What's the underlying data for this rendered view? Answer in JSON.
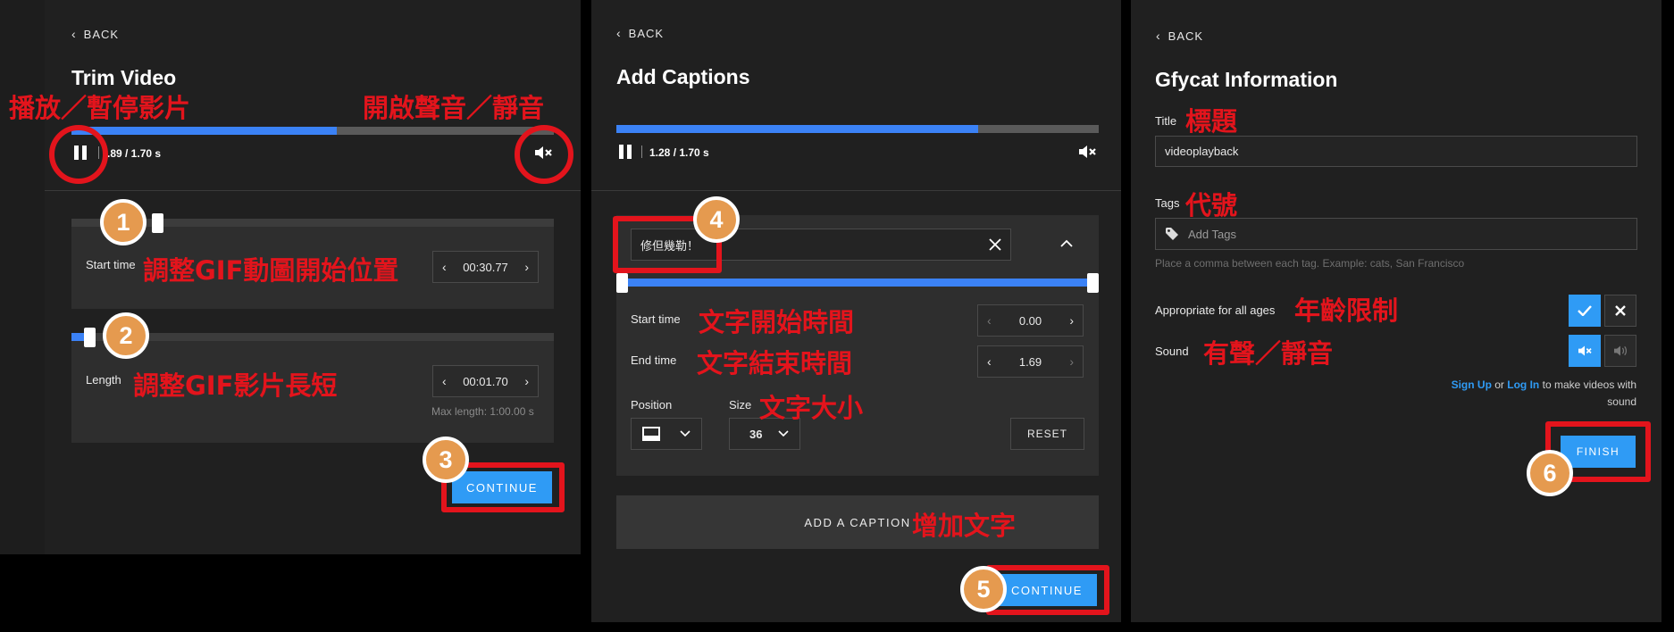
{
  "panel1": {
    "back": "BACK",
    "title": "Trim Video",
    "time": ".89 / 1.70 s",
    "start_label": "Start time",
    "start_value": "00:30.77",
    "length_label": "Length",
    "length_value": "00:01.70",
    "max_length": "Max length: 1:00.00 s",
    "continue": "CONTINUE",
    "progress": 0.55
  },
  "panel2": {
    "back": "BACK",
    "title": "Add Captions",
    "time": "1.28 / 1.70 s",
    "caption_text": "修但幾勒！",
    "start_label": "Start time",
    "start_value": "0.00",
    "end_label": "End time",
    "end_value": "1.69",
    "position_label": "Position",
    "size_label": "Size",
    "size_value": "36",
    "reset": "RESET",
    "add_caption": "ADD A CAPTION",
    "continue": "CONTINUE",
    "progress": 0.75
  },
  "panel3": {
    "back": "BACK",
    "title": "Gfycat Information",
    "title_label": "Title",
    "title_value": "videoplayback",
    "tags_label": "Tags",
    "tags_placeholder": "Add Tags",
    "tags_hint": "Place a comma between each tag. Example: cats, San Francisco",
    "ages_label": "Appropriate for all ages",
    "sound_label": "Sound",
    "signup": "Sign Up",
    "or": "or",
    "login": "Log In",
    "signup_rest": "to make videos with",
    "signup_rest2": "sound",
    "finish": "FINISH"
  },
  "annotations": {
    "play_pause": "播放／暫停影片",
    "sound_toggle": "開啟聲音／靜音",
    "adjust_start": "調整GIF動圖開始位置",
    "adjust_length": "調整GIF影片長短",
    "text_start": "文字開始時間",
    "text_end": "文字結束時間",
    "text_size": "文字大小",
    "add_text": "增加文字",
    "title": "標題",
    "tags": "代號",
    "age_limit": "年齡限制",
    "sound": "有聲／靜音",
    "badges": [
      "1",
      "2",
      "3",
      "4",
      "5",
      "6"
    ]
  },
  "colors": {
    "accent": "#2f9bf5",
    "annotation": "#e3141c",
    "badge": "#e59a4f"
  },
  "icons": [
    "chevron-left-icon",
    "pause-icon",
    "mute-icon",
    "close-icon",
    "chevron-up-icon",
    "chevron-down-icon",
    "tag-icon",
    "check-icon",
    "screen-position-icon"
  ]
}
